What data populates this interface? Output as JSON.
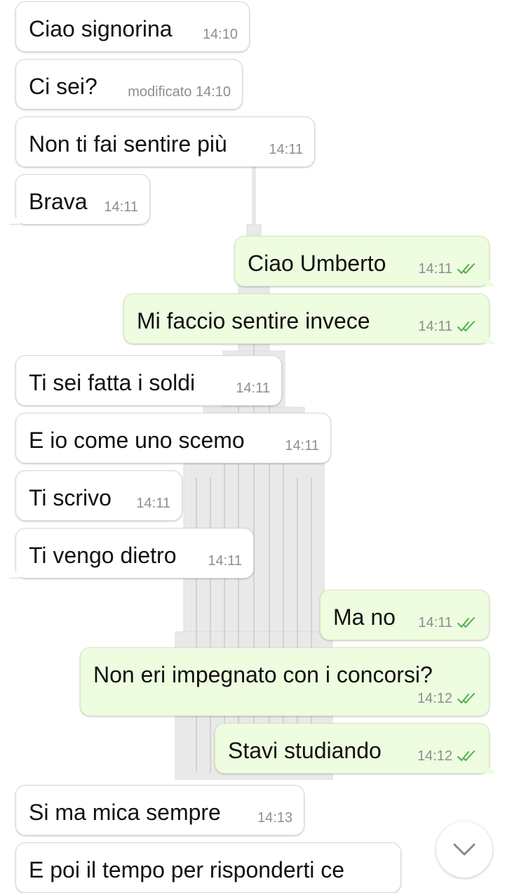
{
  "messages": [
    {
      "dir": "in",
      "text": "Ciao signorina",
      "time": "14:10"
    },
    {
      "dir": "in",
      "text": "Ci sei?",
      "time": "modificato 14:10"
    },
    {
      "dir": "in",
      "text": "Non ti fai sentire più",
      "time": "14:11"
    },
    {
      "dir": "in",
      "text": "Brava",
      "time": "14:11"
    },
    {
      "dir": "out",
      "text": "Ciao Umberto",
      "time": "14:11",
      "status": "read"
    },
    {
      "dir": "out",
      "text": "Mi faccio sentire invece",
      "time": "14:11",
      "status": "read"
    },
    {
      "dir": "in",
      "text": "Ti sei fatta i soldi",
      "time": "14:11"
    },
    {
      "dir": "in",
      "text": "E io come uno scemo",
      "time": "14:11"
    },
    {
      "dir": "in",
      "text": "Ti scrivo",
      "time": "14:11"
    },
    {
      "dir": "in",
      "text": "Ti vengo dietro",
      "time": "14:11"
    },
    {
      "dir": "out",
      "text": "Ma no",
      "time": "14:11",
      "status": "read"
    },
    {
      "dir": "out",
      "text": "Non eri impegnato con i concorsi?",
      "time": "14:12",
      "status": "read"
    },
    {
      "dir": "out",
      "text": "Stavi studiando",
      "time": "14:12",
      "status": "read"
    },
    {
      "dir": "in",
      "text": "Si ma mica sempre",
      "time": "14:13"
    },
    {
      "dir": "in",
      "text": "E poi il tempo per risponderti ce",
      "time": ""
    }
  ],
  "colors": {
    "incoming_bubble": "#ffffff",
    "outgoing_bubble": "#eefcdf",
    "read_check": "#4fae4e",
    "timestamp": "#8e8e8e"
  },
  "icons": {
    "read_receipt": "double-check-icon",
    "scroll_down": "chevron-down-icon"
  }
}
